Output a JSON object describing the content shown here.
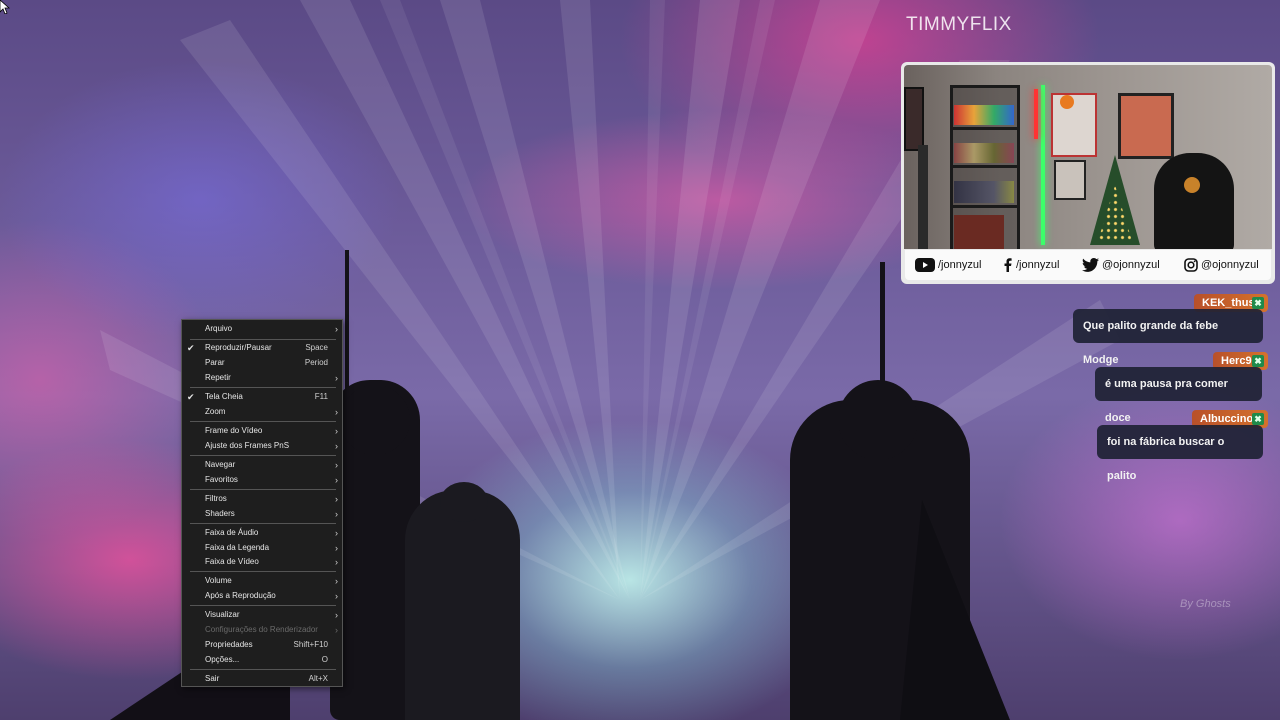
{
  "stream": {
    "channel_name": "TIMMYFLIX",
    "watermark": "By Ghosts"
  },
  "social": {
    "youtube": "/jonnyzul",
    "facebook": "/jonnyzul",
    "twitter": "@ojonnyzul",
    "instagram": "@ojonnyzul"
  },
  "chat": [
    {
      "user": "KEK_thus",
      "message": "Que palito grande da febe Modge"
    },
    {
      "user": "Herc9",
      "message": "é uma pausa pra comer doce"
    },
    {
      "user": "Albuccino",
      "message": "foi na fábrica buscar o palito"
    }
  ],
  "menu": {
    "items": [
      {
        "label": "Arquivo",
        "submenu": true
      },
      {
        "label": "Reproduzir/Pausar",
        "shortcut": "Space",
        "checked": true
      },
      {
        "label": "Parar",
        "shortcut": "Period"
      },
      {
        "label": "Repetir",
        "submenu": true
      },
      {
        "label": "Tela Cheia",
        "shortcut": "F11",
        "checked": true
      },
      {
        "label": "Zoom",
        "submenu": true
      },
      {
        "label": "Frame do Vídeo",
        "submenu": true
      },
      {
        "label": "Ajuste dos Frames PnS",
        "submenu": true
      },
      {
        "label": "Navegar",
        "submenu": true
      },
      {
        "label": "Favoritos",
        "submenu": true
      },
      {
        "label": "Filtros",
        "submenu": true
      },
      {
        "label": "Shaders",
        "submenu": true
      },
      {
        "label": "Faixa de Áudio",
        "submenu": true
      },
      {
        "label": "Faixa da Legenda",
        "submenu": true
      },
      {
        "label": "Faixa de Vídeo",
        "submenu": true
      },
      {
        "label": "Volume",
        "submenu": true
      },
      {
        "label": "Após a Reprodução",
        "submenu": true
      },
      {
        "label": "Visualizar",
        "submenu": true
      },
      {
        "label": "Configurações do Renderizador",
        "submenu": true,
        "disabled": true
      },
      {
        "label": "Propriedades",
        "shortcut": "Shift+F10"
      },
      {
        "label": "Opções...",
        "shortcut": "O"
      },
      {
        "label": "Sair",
        "shortcut": "Alt+X"
      }
    ]
  },
  "colors": {
    "menu_bg": "#1e1e1e",
    "chat_name_bg": "#c8612b",
    "chat_msg_bg": "#1e2234",
    "badge": "#1f8a4a"
  }
}
